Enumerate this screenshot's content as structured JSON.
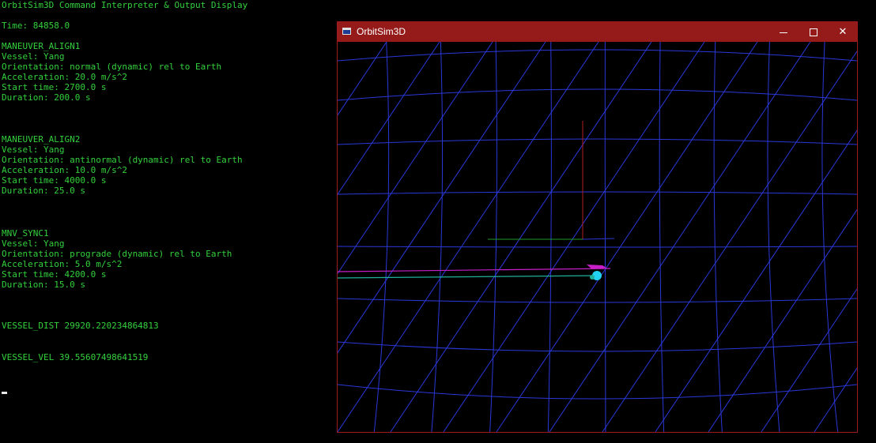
{
  "console": {
    "header": "OrbitSim3D Command Interpreter & Output Display",
    "time": "Time: 84858.0",
    "maneuvers": [
      {
        "name": "MANEUVER_ALIGN1",
        "vessel": "Vessel: Yang",
        "orientation": "Orientation: normal (dynamic) rel to Earth",
        "acceleration": "Acceleration: 20.0 m/s^2",
        "start_time": "Start time: 2700.0 s",
        "duration": "Duration: 200.0 s"
      },
      {
        "name": "MANEUVER_ALIGN2",
        "vessel": "Vessel: Yang",
        "orientation": "Orientation: antinormal (dynamic) rel to Earth",
        "acceleration": "Acceleration: 10.0 m/s^2",
        "start_time": "Start time: 4000.0 s",
        "duration": "Duration: 25.0 s"
      },
      {
        "name": "MNV_SYNC1",
        "vessel": "Vessel: Yang",
        "orientation": "Orientation: prograde (dynamic) rel to Earth",
        "acceleration": "Acceleration: 5.0 m/s^2",
        "start_time": "Start time: 4200.0 s",
        "duration": "Duration: 15.0 s"
      }
    ],
    "vessel_dist": "VESSEL_DIST 29920.220234864813",
    "vessel_vel": "VESSEL_VEL 39.55607498641519"
  },
  "window": {
    "title": "OrbitSim3D",
    "minimize_icon": "minimize-icon",
    "maximize_icon": "maximize-icon",
    "close_icon": "close-icon",
    "close_glyph": "✕"
  },
  "colors": {
    "console_text": "#33d13d",
    "titlebar": "#951b1b",
    "grid": "#2a38d8",
    "axis_red": "#b01f1f",
    "axis_green": "#1f9a2a",
    "orbit_magenta": "#c81fc8",
    "orbit_teal": "#1fb09a",
    "vessel_cyan": "#22d0f0"
  }
}
